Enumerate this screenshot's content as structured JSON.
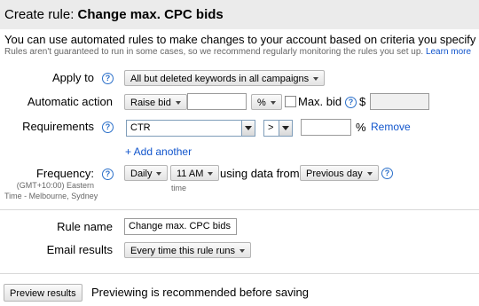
{
  "header": {
    "prefix": "Create rule: ",
    "name": "Change max. CPC bids"
  },
  "intro": "You can use automated rules to make changes to your account based on criteria you specify -- sa",
  "sub": {
    "text": "Rules aren't guaranteed to run in some cases, so we recommend regularly monitoring the rules you set up.",
    "link": "Learn more"
  },
  "apply_to": {
    "label": "Apply to",
    "value": "All but deleted keywords in all campaigns"
  },
  "action": {
    "label": "Automatic action",
    "value": "Raise bid",
    "amount": "",
    "unit": "%",
    "max_bid_label": "Max. bid",
    "currency": "$",
    "max_bid_value": ""
  },
  "requirements": {
    "label": "Requirements",
    "metric": "CTR",
    "operator": ">",
    "value": "",
    "unit": "%",
    "remove": "Remove",
    "add_another": "+ Add another"
  },
  "frequency": {
    "label": "Frequency:",
    "tz1": "(GMT+10:00) Eastern",
    "tz2": "Time - Melbourne, Sydney",
    "period": "Daily",
    "time": "11 AM",
    "time_caption": "time",
    "using_text": "using data from",
    "data_range": "Previous day"
  },
  "rule_name": {
    "label": "Rule name",
    "value": "Change max. CPC bids"
  },
  "email": {
    "label": "Email results",
    "value": "Every time this rule runs"
  },
  "preview": {
    "button": "Preview results",
    "note": "Previewing is recommended before saving"
  },
  "help_glyph": "?"
}
